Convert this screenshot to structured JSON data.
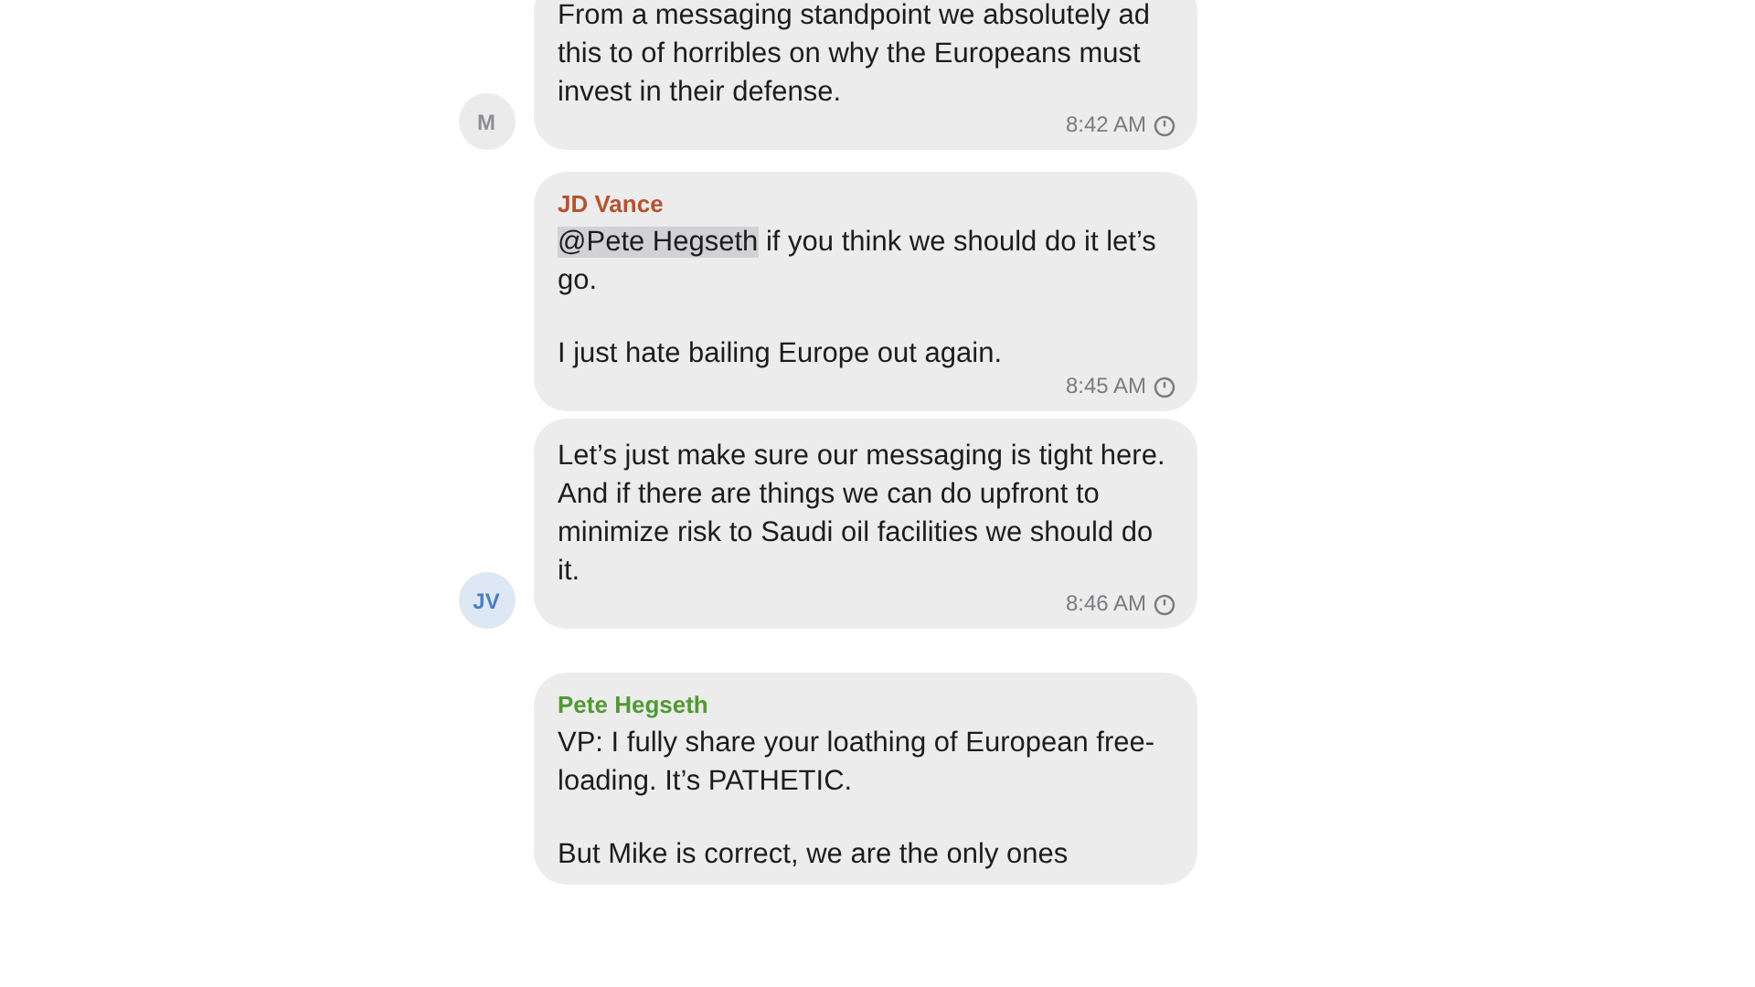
{
  "messages": [
    {
      "paragraphs": [
        {
          "text": "From a messaging standpoint we absolutely ad this to of horribles on why the Europeans must invest in their defense."
        }
      ],
      "time": "8:42 AM",
      "avatar": {
        "initials": "M",
        "color": "#8e8e93"
      }
    },
    {
      "sender": {
        "name": "JD Vance",
        "color": "#b4532f"
      },
      "paragraphs": [
        {
          "mention": "@Pete Hegseth",
          "text": " if you think we should do it let’s go."
        },
        {
          "text": "I just hate bailing Europe out again."
        }
      ],
      "time": "8:45 AM"
    },
    {
      "paragraphs": [
        {
          "text": "Let’s just make sure our messaging is tight here. And if there are things we can do upfront to minimize risk to Saudi oil facilities we should do it."
        }
      ],
      "time": "8:46 AM",
      "avatar": {
        "initials": "JV",
        "color": "#4a7fc1"
      }
    },
    {
      "sender": {
        "name": "Pete Hegseth",
        "color": "#4f9a32"
      },
      "paragraphs": [
        {
          "text": "VP: I fully share your loathing of European free-loading. It’s PATHETIC."
        },
        {
          "text": "But Mike is correct, we are the only ones"
        }
      ]
    }
  ]
}
